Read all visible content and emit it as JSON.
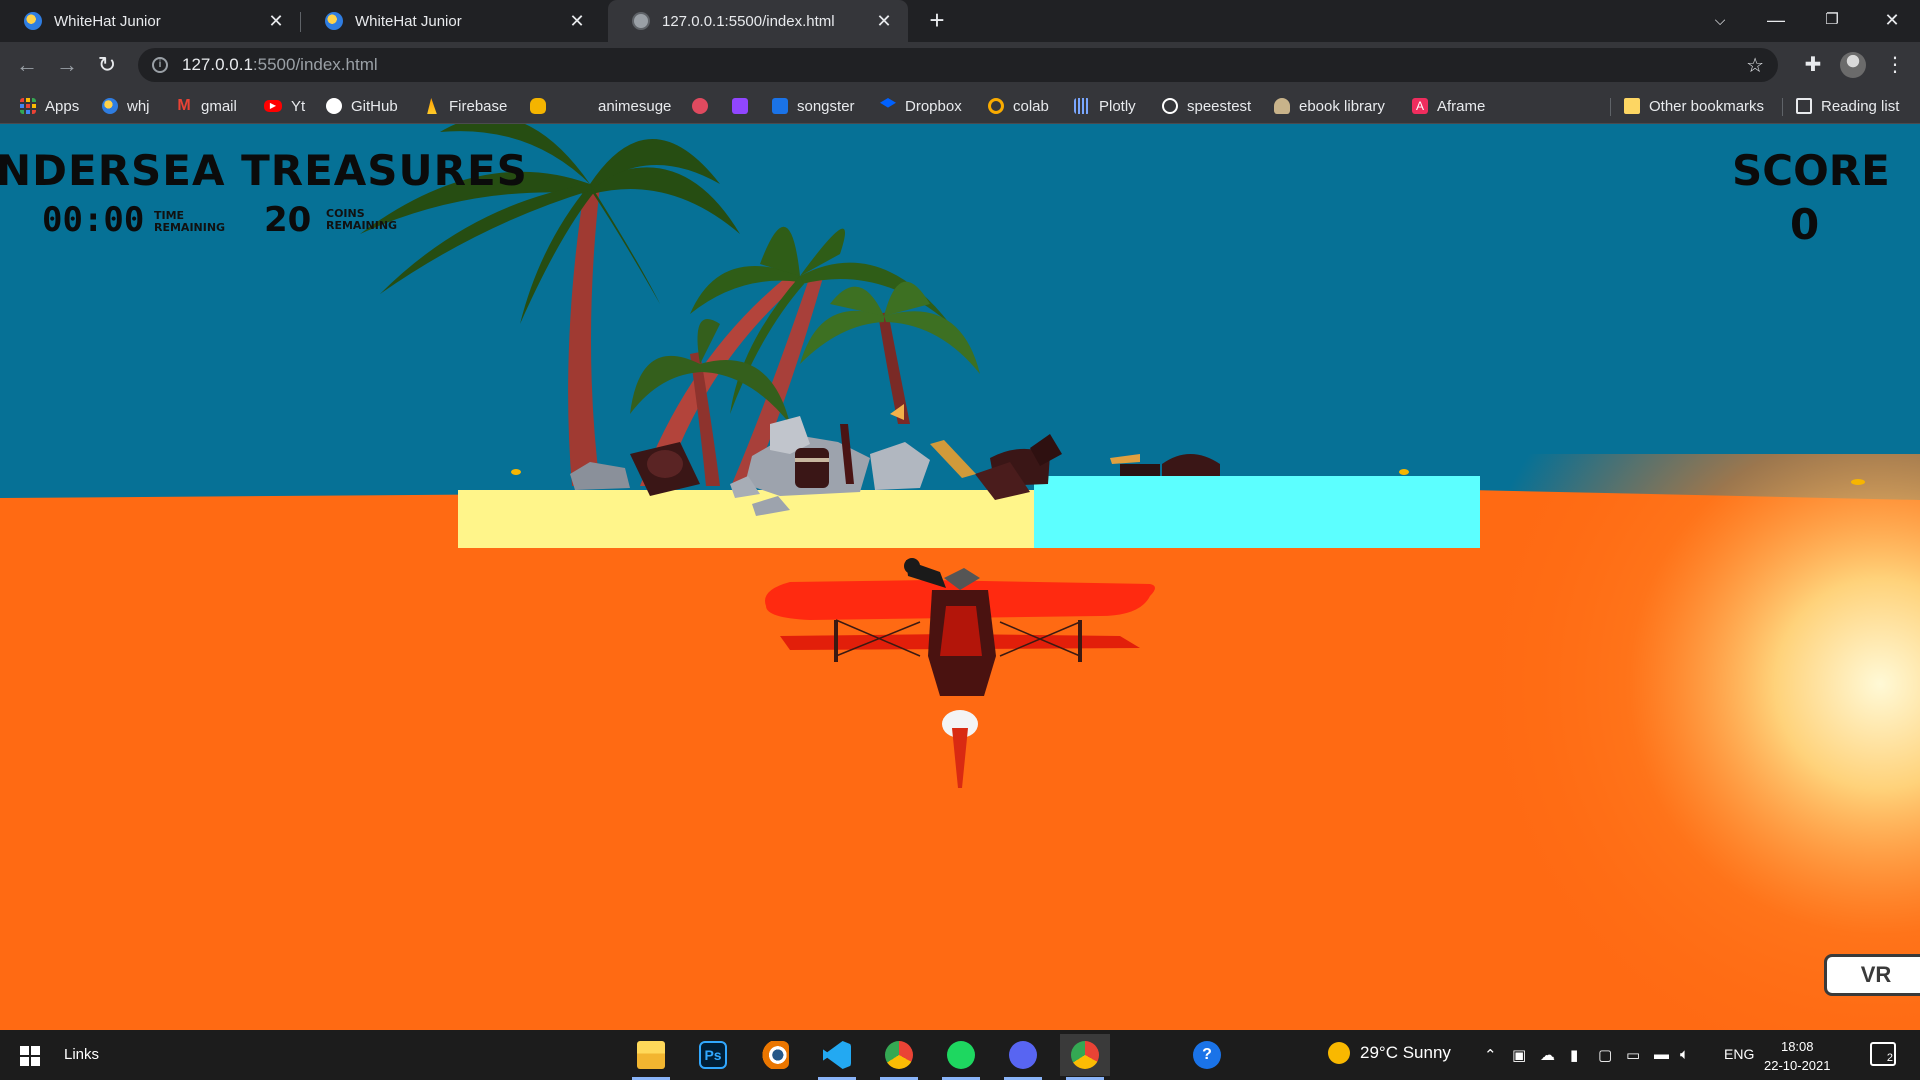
{
  "browser": {
    "tabs": [
      {
        "title": "WhiteHat Junior",
        "icon": "whitehat-favicon",
        "active": false
      },
      {
        "title": "WhiteHat Junior",
        "icon": "whitehat-favicon",
        "active": false
      },
      {
        "title": "127.0.0.1:5500/index.html",
        "icon": "globe-icon",
        "active": true
      }
    ],
    "address": {
      "host": "127.0.0.1",
      "path": ":5500/index.html"
    },
    "bookmarks": [
      {
        "label": "Apps",
        "icon": "apps-grid-icon",
        "color": "#ea4335"
      },
      {
        "label": "whj",
        "icon": "whitehat-favicon",
        "color": "#2f7de1"
      },
      {
        "label": "gmail",
        "icon": "gmail-icon",
        "color": "#ea4335"
      },
      {
        "label": "Yt",
        "icon": "youtube-icon",
        "color": "#ff0000"
      },
      {
        "label": "GitHub",
        "icon": "github-icon",
        "color": "#ffffff"
      },
      {
        "label": "Firebase",
        "icon": "firebase-icon",
        "color": "#ffca28"
      },
      {
        "label": "",
        "icon": "cat-icon",
        "color": "#f4b400"
      },
      {
        "label": "animesuge",
        "icon": "",
        "color": ""
      },
      {
        "label": "",
        "icon": "pinwheel-icon",
        "color": "#e04a5f"
      },
      {
        "label": "",
        "icon": "twitch-icon",
        "color": "#9146ff"
      },
      {
        "label": "songster",
        "icon": "songsterr-icon",
        "color": "#1a73e8"
      },
      {
        "label": "Dropbox",
        "icon": "dropbox-icon",
        "color": "#0061ff"
      },
      {
        "label": "colab",
        "icon": "colab-icon",
        "color": "#f9ab00"
      },
      {
        "label": "Plotly",
        "icon": "plotly-icon",
        "color": "#7aa7ff"
      },
      {
        "label": "speestest",
        "icon": "speedtest-icon",
        "color": "#ffffff"
      },
      {
        "label": "ebook library",
        "icon": "ebook-icon",
        "color": "#c8b38a"
      },
      {
        "label": "Aframe",
        "icon": "aframe-icon",
        "color": "#ef2d5e"
      }
    ],
    "other_bookmarks": "Other bookmarks",
    "reading_list": "Reading list"
  },
  "game": {
    "title": "NDERSEA TREASURES",
    "timer": "00:00",
    "time_label": [
      "TIME",
      "REMAINING"
    ],
    "coins": "20",
    "coins_label": [
      "COINS",
      "REMAINING"
    ],
    "score_label": "SCORE",
    "score": "0",
    "vr_label": "VR",
    "colors": {
      "sky": "#067196",
      "floor": "#ff6a13",
      "sand": "#fff58a",
      "water": "#5cffff",
      "plane": "#ff2a10"
    }
  },
  "taskbar": {
    "links_label": "Links",
    "apps": [
      "file-explorer-icon",
      "photoshop-icon",
      "blender-icon",
      "vscode-icon",
      "chrome-icon",
      "spotify-icon",
      "discord-icon",
      "chrome-active-icon"
    ],
    "photoshop_label": "Ps",
    "weather": "29°C  Sunny",
    "language": "ENG",
    "time": "18:08",
    "date": "22-10-2021",
    "notifications": "2"
  }
}
